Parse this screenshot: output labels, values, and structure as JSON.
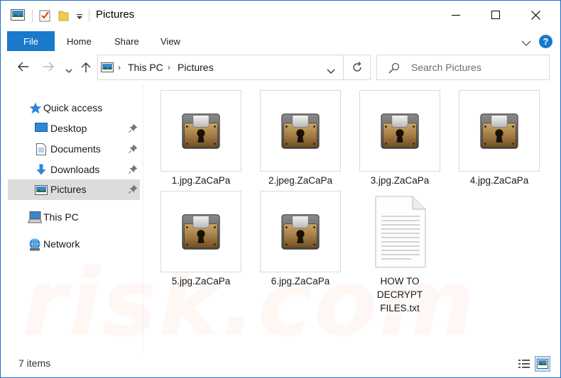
{
  "window": {
    "title": "Pictures",
    "accent_color": "#1979ca"
  },
  "ribbon": {
    "tabs": [
      {
        "label": "File"
      },
      {
        "label": "Home"
      },
      {
        "label": "Share"
      },
      {
        "label": "View"
      }
    ],
    "help_label": "?"
  },
  "address": {
    "breadcrumbs": [
      {
        "label": "This PC"
      },
      {
        "label": "Pictures"
      }
    ],
    "search_placeholder": "Search Pictures"
  },
  "navpane": {
    "items": [
      {
        "label": "Quick access",
        "icon": "star-icon"
      },
      {
        "label": "Desktop",
        "icon": "desktop-icon",
        "pinned": true
      },
      {
        "label": "Documents",
        "icon": "documents-icon",
        "pinned": true
      },
      {
        "label": "Downloads",
        "icon": "downloads-icon",
        "pinned": true
      },
      {
        "label": "Pictures",
        "icon": "pictures-icon",
        "pinned": true,
        "selected": true
      },
      {
        "label": "This PC",
        "icon": "computer-icon"
      },
      {
        "label": "Network",
        "icon": "network-icon"
      }
    ]
  },
  "files": [
    {
      "name": "1.jpg.ZaCaPa",
      "icon": "lock-icon"
    },
    {
      "name": "2.jpeg.ZaCaPa",
      "icon": "lock-icon"
    },
    {
      "name": "3.jpg.ZaCaPa",
      "icon": "lock-icon"
    },
    {
      "name": "4.jpg.ZaCaPa",
      "icon": "lock-icon"
    },
    {
      "name": "5.jpg.ZaCaPa",
      "icon": "lock-icon"
    },
    {
      "name": "6.jpg.ZaCaPa",
      "icon": "lock-icon"
    },
    {
      "name_lines": [
        "HOW TO",
        "DECRYPT",
        "FILES.txt"
      ],
      "icon": "text-file-icon"
    }
  ],
  "status": {
    "item_count": "7 items"
  }
}
